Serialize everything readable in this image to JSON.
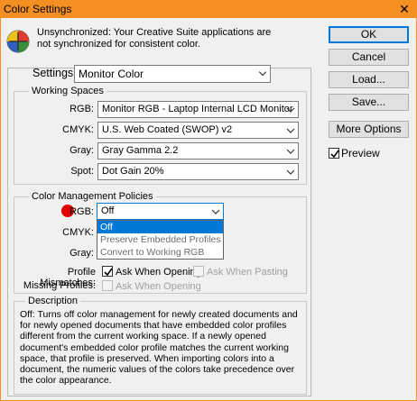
{
  "window": {
    "title": "Color Settings",
    "close_glyph": "✕"
  },
  "message": "Unsynchronized: Your Creative Suite applications are not synchronized for consistent color.",
  "buttons": {
    "ok": "OK",
    "cancel": "Cancel",
    "load": "Load...",
    "save": "Save...",
    "more_options": "More Options"
  },
  "preview": {
    "label": "Preview",
    "checked": true
  },
  "settings": {
    "label": "Settings:",
    "value": "Monitor Color"
  },
  "working_spaces": {
    "title": "Working Spaces",
    "rgb": {
      "label": "RGB:",
      "value": "Monitor RGB - Laptop Internal LCD Monitor"
    },
    "cmyk": {
      "label": "CMYK:",
      "value": "U.S. Web Coated (SWOP) v2"
    },
    "gray": {
      "label": "Gray:",
      "value": "Gray Gamma 2.2"
    },
    "spot": {
      "label": "Spot:",
      "value": "Dot Gain 20%"
    }
  },
  "policies": {
    "title": "Color Management Policies",
    "rgb": {
      "label": "RGB:",
      "value": "Off"
    },
    "cmyk": {
      "label": "CMYK:"
    },
    "gray": {
      "label": "Gray:"
    },
    "dropdown_options": [
      "Off",
      "Preserve Embedded Profiles",
      "Convert to Working RGB"
    ],
    "profile_mismatches": {
      "label": "Profile Mismatches:",
      "ask_opening": "Ask When Opening",
      "ask_opening_checked": true,
      "ask_pasting": "Ask When Pasting"
    },
    "missing_profiles": {
      "label": "Missing Profiles:",
      "ask_opening": "Ask When Opening"
    }
  },
  "description": {
    "title": "Description",
    "text": "Off:  Turns off color management for newly created documents and for newly opened documents that have embedded color profiles different from the current working space.  If a newly opened document's embedded color profile matches the current working space, that profile is preserved.  When importing colors into a document, the numeric values of the colors take precedence over the color appearance."
  },
  "colors": {
    "titlebar": "#f49022",
    "focus": "#0078d7",
    "marker": "#e00000"
  }
}
